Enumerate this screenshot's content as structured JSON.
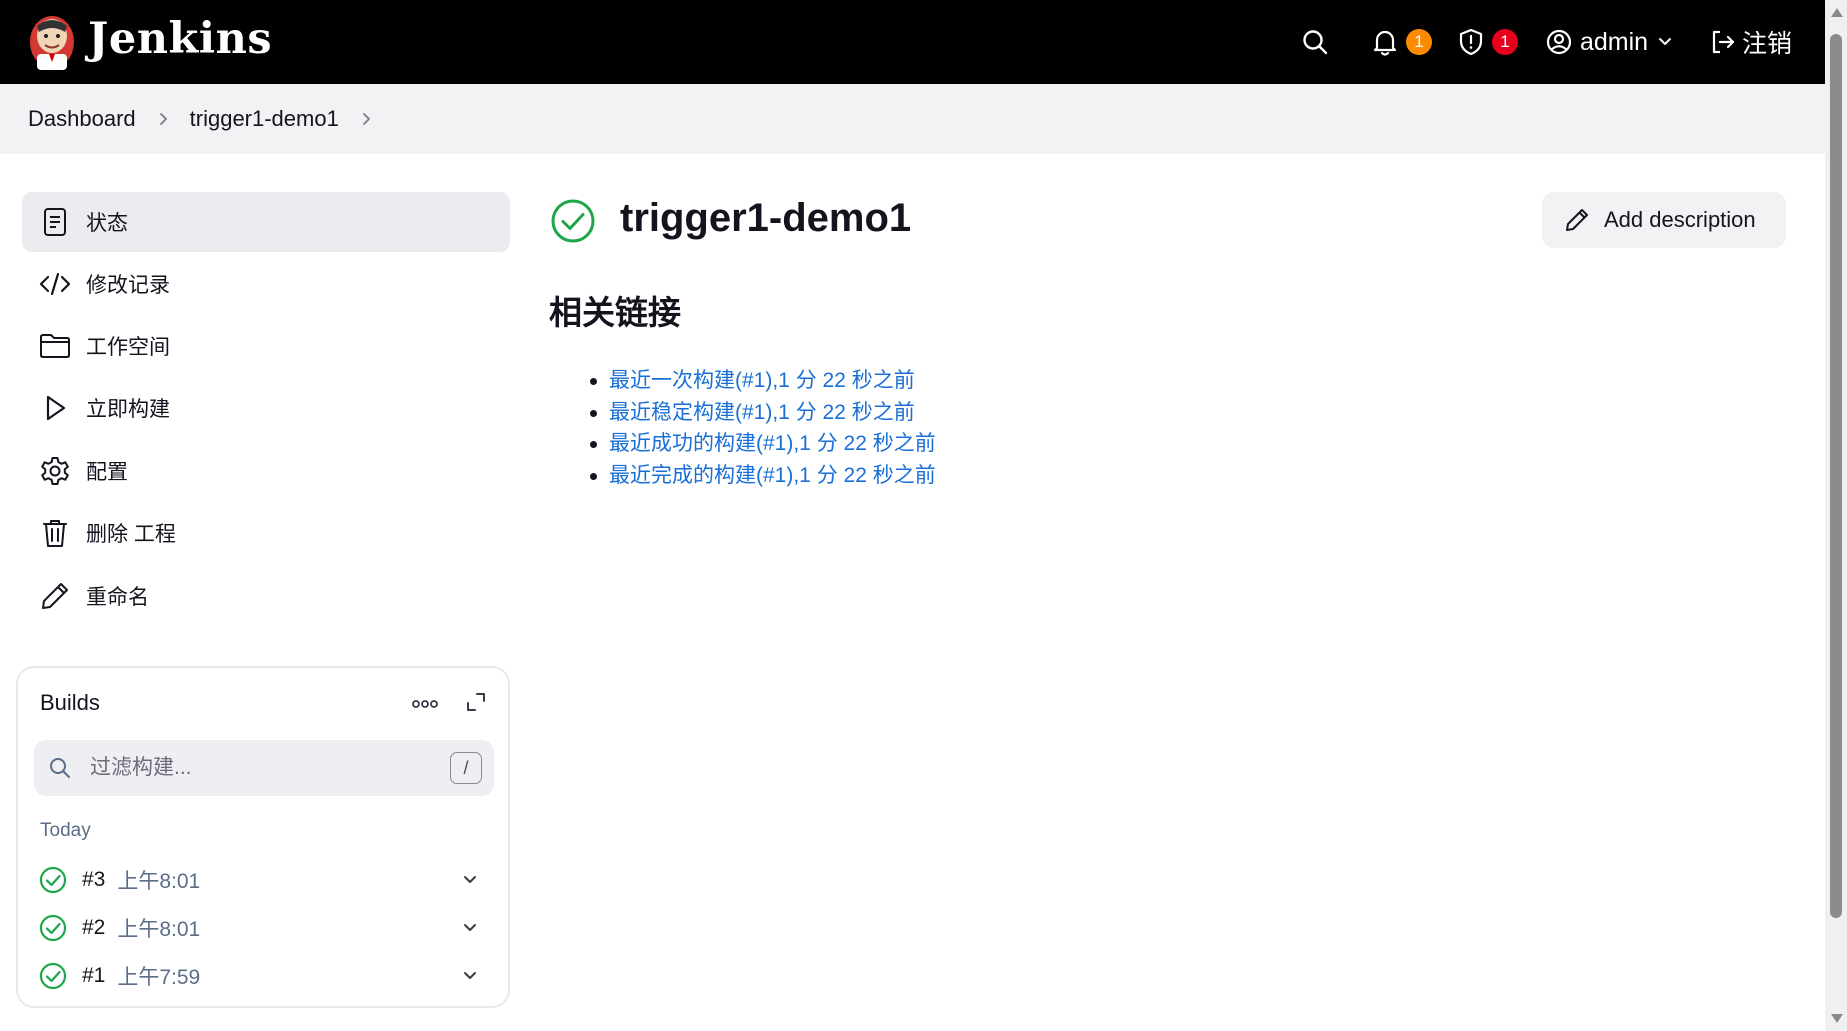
{
  "header": {
    "brand": "Jenkins",
    "notifications_count": "1",
    "security_count": "1",
    "user": "admin",
    "logout_label": "注销"
  },
  "breadcrumb": [
    "Dashboard",
    "trigger1-demo1"
  ],
  "sidebar": {
    "items": [
      {
        "label": "状态",
        "icon": "notepad-icon",
        "active": true
      },
      {
        "label": "修改记录",
        "icon": "code-icon"
      },
      {
        "label": "工作空间",
        "icon": "folder-icon"
      },
      {
        "label": "立即构建",
        "icon": "play-icon"
      },
      {
        "label": "配置",
        "icon": "gear-icon"
      },
      {
        "label": "删除 工程",
        "icon": "trash-icon"
      },
      {
        "label": "重命名",
        "icon": "pencil-icon"
      }
    ]
  },
  "builds": {
    "title": "Builds",
    "search_placeholder": "过滤构建...",
    "shortcut_key": "/",
    "group_label": "Today",
    "items": [
      {
        "number": "#3",
        "time": "上午8:01",
        "status": "success"
      },
      {
        "number": "#2",
        "time": "上午8:01",
        "status": "success"
      },
      {
        "number": "#1",
        "time": "上午7:59",
        "status": "success"
      }
    ]
  },
  "main": {
    "job_name": "trigger1-demo1",
    "job_status": "success",
    "add_description_label": "Add description",
    "section_title": "相关链接",
    "links": [
      "最近一次构建(#1),1 分 22 秒之前",
      "最近稳定构建(#1),1 分 22 秒之前",
      "最近成功的构建(#1),1 分 22 秒之前",
      "最近完成的构建(#1),1 分 22 秒之前"
    ]
  },
  "colors": {
    "header_bg": "#000000",
    "success_green": "#1ea64b",
    "link_blue": "#1a6fd6",
    "notification_badge": "#fe8a00",
    "security_badge": "#e6001e"
  }
}
